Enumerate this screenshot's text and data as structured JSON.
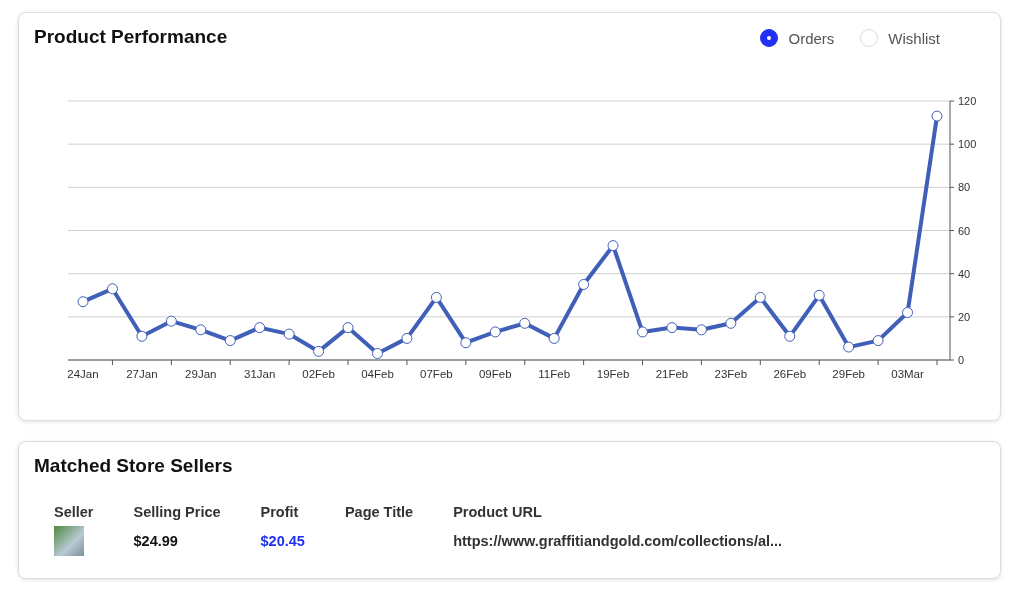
{
  "performance": {
    "title": "Product Performance",
    "legend": [
      {
        "label": "Orders",
        "selected": true
      },
      {
        "label": "Wishlist",
        "selected": false
      }
    ],
    "chart_data": {
      "type": "line",
      "categories": [
        "24Jan",
        null,
        "27Jan",
        null,
        "29Jan",
        null,
        "31Jan",
        null,
        "02Feb",
        null,
        "04Feb",
        null,
        "07Feb",
        null,
        "09Feb",
        null,
        "11Feb",
        null,
        "19Feb",
        null,
        "21Feb",
        null,
        "23Feb",
        null,
        "26Feb",
        null,
        "29Feb",
        null,
        "03Mar",
        null
      ],
      "series": [
        {
          "color": "#3f5fb8",
          "marker": "circle",
          "values": [
            27,
            33,
            11,
            18,
            14,
            9,
            15,
            12,
            4,
            15,
            3,
            10,
            29,
            8,
            13,
            17,
            10,
            35,
            53,
            13,
            15,
            14,
            17,
            29,
            11,
            30,
            6,
            9,
            22,
            113
          ]
        }
      ],
      "grid": true,
      "ylim": [
        0,
        120
      ],
      "yticks": [
        0,
        20,
        40,
        60,
        80,
        100,
        120
      ]
    }
  },
  "sellers": {
    "title": "Matched Store Sellers",
    "columns": [
      "Seller",
      "Selling Price",
      "Profit",
      "Page Title",
      "Product URL"
    ],
    "rows": [
      {
        "selling_price": "$24.99",
        "profit": "$20.45",
        "product_url": "https://www.graffitiandgold.com/collections/al..."
      }
    ]
  }
}
